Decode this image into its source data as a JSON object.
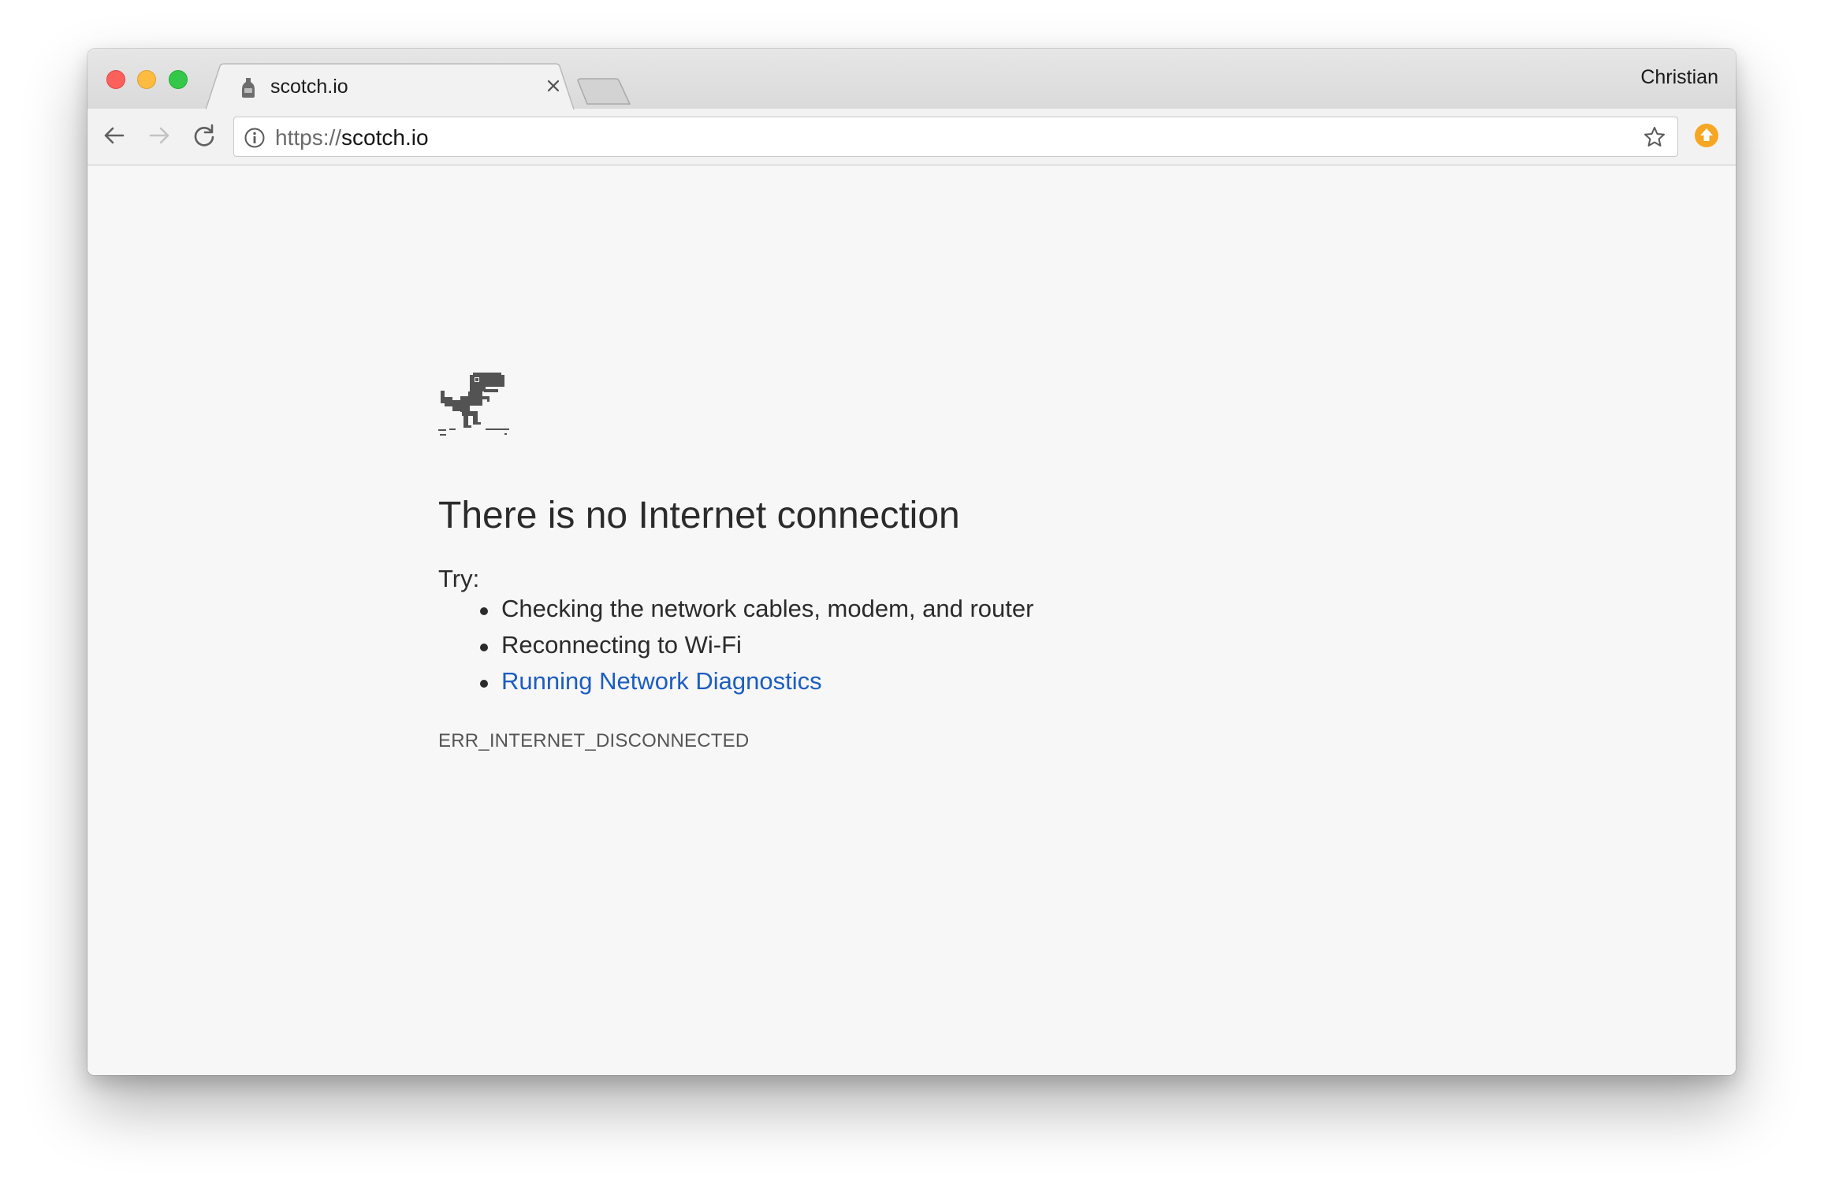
{
  "browser": {
    "profile_name": "Christian",
    "tab": {
      "title": "scotch.io",
      "favicon": "scotch-favicon"
    },
    "url": {
      "scheme": "https://",
      "host": "scotch.io"
    },
    "icons": {
      "back": "back-arrow-icon",
      "forward": "forward-arrow-icon",
      "reload": "reload-icon",
      "info": "info-icon",
      "bookmark": "star-icon",
      "extension": "update-arrow-icon"
    }
  },
  "page": {
    "heading": "There is no Internet connection",
    "try_label": "Try:",
    "suggestions": [
      "Checking the network cables, modem, and router",
      "Reconnecting to Wi-Fi",
      "Running Network Diagnostics"
    ],
    "error_code": "ERR_INTERNET_DISCONNECTED"
  },
  "colors": {
    "link": "#1c5dc2",
    "text": "#2b2b2b",
    "page_background": "#f7f7f7",
    "extension_badge": "#f5a623"
  }
}
